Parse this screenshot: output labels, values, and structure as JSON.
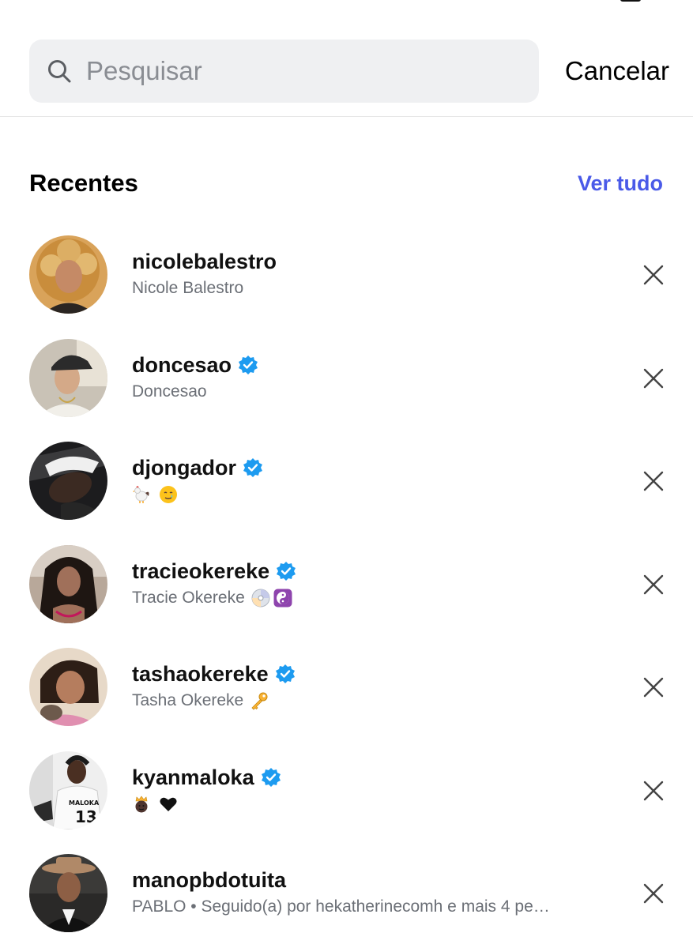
{
  "search": {
    "placeholder": "Pesquisar",
    "value": "",
    "cancel_label": "Cancelar"
  },
  "recent": {
    "title": "Recentes",
    "see_all_label": "Ver tudo"
  },
  "colors": {
    "accent": "#4a5ae8",
    "verified": "#1d9bf0",
    "search_bg": "#eff0f2",
    "subtitle": "#6b6f76"
  },
  "items": [
    {
      "username": "nicolebalestro",
      "subtitle": "Nicole Balestro",
      "verified": false,
      "emojis": []
    },
    {
      "username": "doncesao",
      "subtitle": "Doncesao",
      "verified": true,
      "emojis": []
    },
    {
      "username": "djongador",
      "subtitle": "",
      "verified": true,
      "emojis": [
        "rooster-emoji",
        "crying-smile-emoji"
      ]
    },
    {
      "username": "tracieokereke",
      "subtitle": "Tracie Okereke",
      "verified": true,
      "emojis": [
        "cd-disc-emoji",
        "yin-yang-emoji"
      ]
    },
    {
      "username": "tashaokereke",
      "subtitle": "Tasha Okereke",
      "verified": true,
      "emojis": [
        "key-emoji"
      ]
    },
    {
      "username": "kyanmaloka",
      "subtitle": "",
      "verified": true,
      "emojis": [
        "crowned-face-emoji",
        "black-heart-emoji"
      ]
    },
    {
      "username": "manopbdotuita",
      "subtitle": "PABLO • Seguido(a) por hekatherinecomh e mais 4 pe…",
      "verified": false,
      "emojis": []
    }
  ]
}
